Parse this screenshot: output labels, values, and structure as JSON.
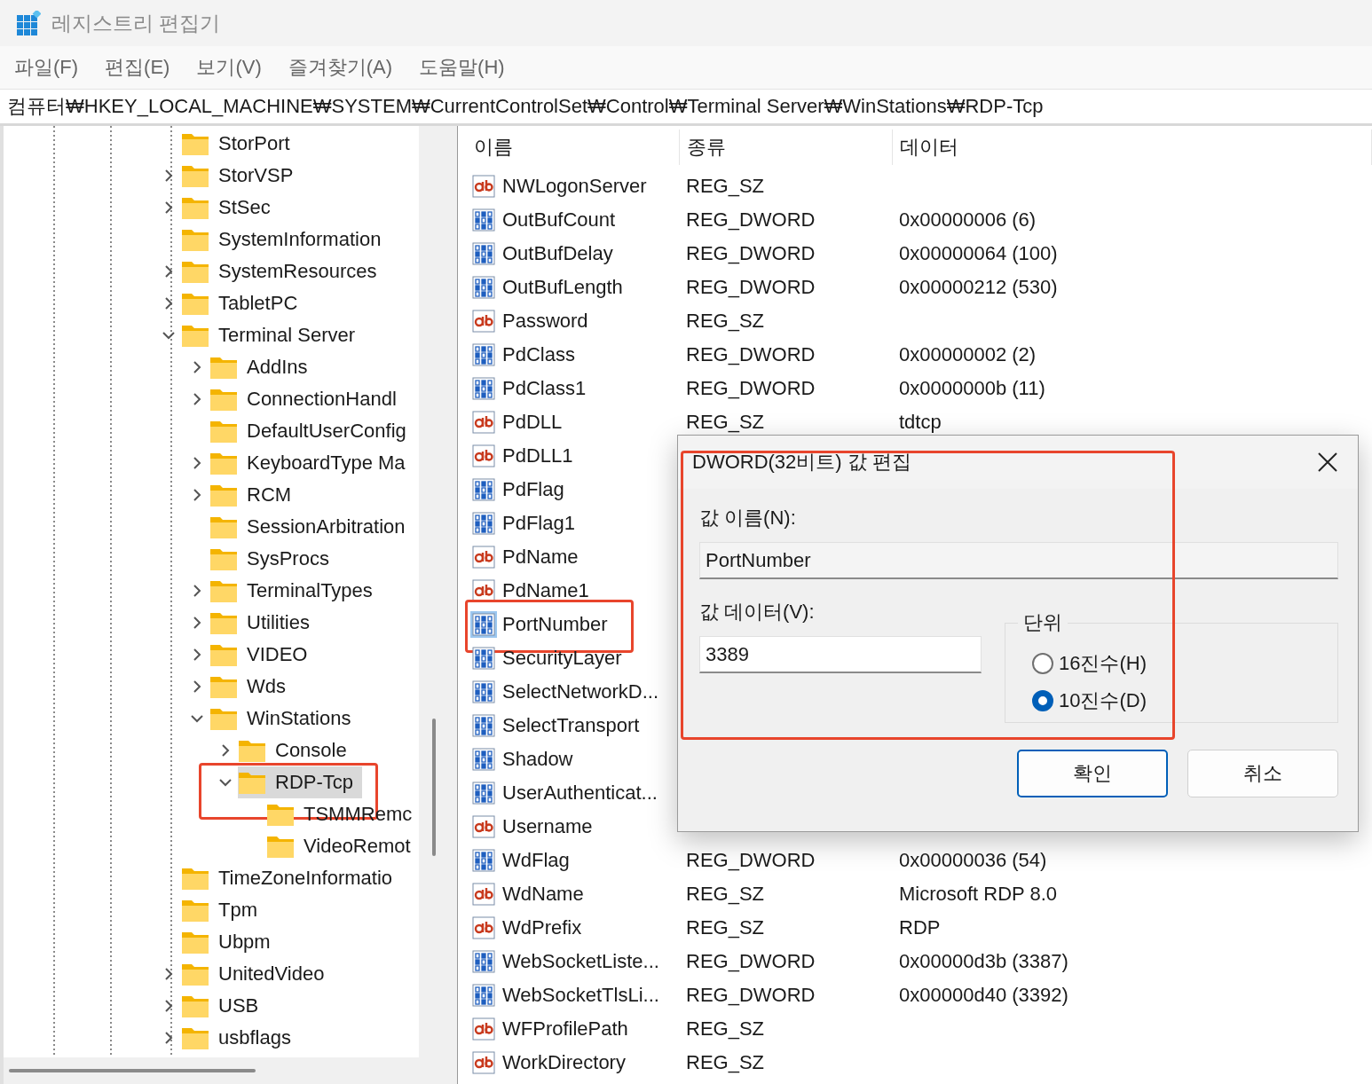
{
  "window": {
    "title": "레지스트리 편집기"
  },
  "menu": [
    "파일(F)",
    "편집(E)",
    "보기(V)",
    "즐겨찾기(A)",
    "도움말(H)"
  ],
  "address": "컴퓨터₩HKEY_LOCAL_MACHINE₩SYSTEM₩CurrentControlSet₩Control₩Terminal Server₩WinStations₩RDP-Tcp",
  "tree": [
    {
      "label": "StorPort"
    },
    {
      "label": "StorVSP",
      "expanded": false
    },
    {
      "label": "StSec",
      "expanded": false
    },
    {
      "label": "SystemInformation"
    },
    {
      "label": "SystemResources",
      "expanded": false
    },
    {
      "label": "TabletPC",
      "expanded": false
    },
    {
      "label": "Terminal Server",
      "expanded": true,
      "children": [
        {
          "label": "AddIns",
          "expanded": false
        },
        {
          "label": "ConnectionHandl",
          "expanded": false
        },
        {
          "label": "DefaultUserConfig"
        },
        {
          "label": "KeyboardType Ma",
          "expanded": false
        },
        {
          "label": "RCM",
          "expanded": false
        },
        {
          "label": "SessionArbitration"
        },
        {
          "label": "SysProcs"
        },
        {
          "label": "TerminalTypes",
          "expanded": false
        },
        {
          "label": "Utilities",
          "expanded": false
        },
        {
          "label": "VIDEO",
          "expanded": false
        },
        {
          "label": "Wds",
          "expanded": false
        },
        {
          "label": "WinStations",
          "expanded": true,
          "children": [
            {
              "label": "Console",
              "expanded": false
            },
            {
              "label": "RDP-Tcp",
              "expanded": true,
              "selected": true,
              "annotated": true,
              "children": [
                {
                  "label": "TSMMRemc"
                },
                {
                  "label": "VideoRemot"
                }
              ]
            }
          ]
        }
      ]
    },
    {
      "label": "TimeZoneInformatio"
    },
    {
      "label": "Tpm"
    },
    {
      "label": "Ubpm"
    },
    {
      "label": "UnitedVideo",
      "expanded": false
    },
    {
      "label": "USB",
      "expanded": false
    },
    {
      "label": "usbflags",
      "expanded": false
    }
  ],
  "table": {
    "columns": [
      "이름",
      "종류",
      "데이터"
    ],
    "rows": [
      {
        "kind": "string",
        "name": "NWLogonServer",
        "type": "REG_SZ",
        "selected": false
      },
      {
        "kind": "binary",
        "name": "OutBufCount",
        "type": "REG_DWORD",
        "data": "0x00000006 (6)",
        "selected": false
      },
      {
        "kind": "binary",
        "name": "OutBufDelay",
        "type": "REG_DWORD",
        "data": "0x00000064 (100)",
        "selected": false
      },
      {
        "kind": "binary",
        "name": "OutBufLength",
        "type": "REG_DWORD",
        "data": "0x00000212 (530)",
        "selected": false
      },
      {
        "kind": "string",
        "name": "Password",
        "type": "REG_SZ",
        "selected": false
      },
      {
        "kind": "binary",
        "name": "PdClass",
        "type": "REG_DWORD",
        "data": "0x00000002 (2)",
        "selected": false
      },
      {
        "kind": "binary",
        "name": "PdClass1",
        "type": "REG_DWORD",
        "data": "0x0000000b (11)",
        "selected": false
      },
      {
        "kind": "string",
        "name": "PdDLL",
        "type": "REG_SZ",
        "data": "tdtcp",
        "selected": false
      },
      {
        "kind": "string",
        "name": "PdDLL1",
        "selected": false
      },
      {
        "kind": "binary",
        "name": "PdFlag",
        "selected": false
      },
      {
        "kind": "binary",
        "name": "PdFlag1",
        "selected": false
      },
      {
        "kind": "string",
        "name": "PdName",
        "selected": false
      },
      {
        "kind": "string",
        "name": "PdName1",
        "selected": false
      },
      {
        "kind": "binary",
        "name": "PortNumber",
        "selected": true,
        "annotated": true
      },
      {
        "kind": "binary",
        "name": "SecurityLayer",
        "selected": false
      },
      {
        "kind": "binary",
        "name": "SelectNetworkD...",
        "selected": false
      },
      {
        "kind": "binary",
        "name": "SelectTransport",
        "selected": false
      },
      {
        "kind": "binary",
        "name": "Shadow",
        "selected": false
      },
      {
        "kind": "binary",
        "name": "UserAuthenticat...",
        "selected": false
      },
      {
        "kind": "string",
        "name": "Username",
        "selected": false
      },
      {
        "kind": "binary",
        "name": "WdFlag",
        "type": "REG_DWORD",
        "data": "0x00000036 (54)",
        "selected": false
      },
      {
        "kind": "string",
        "name": "WdName",
        "type": "REG_SZ",
        "data": "Microsoft RDP 8.0",
        "selected": false
      },
      {
        "kind": "string",
        "name": "WdPrefix",
        "type": "REG_SZ",
        "data": "RDP",
        "selected": false
      },
      {
        "kind": "binary",
        "name": "WebSocketListe...",
        "type": "REG_DWORD",
        "data": "0x00000d3b (3387)",
        "selected": false
      },
      {
        "kind": "binary",
        "name": "WebSocketTlsLi...",
        "type": "REG_DWORD",
        "data": "0x00000d40 (3392)",
        "selected": false
      },
      {
        "kind": "string",
        "name": "WFProfilePath",
        "type": "REG_SZ",
        "selected": false
      },
      {
        "kind": "string",
        "name": "WorkDirectory",
        "type": "REG_SZ",
        "selected": false
      }
    ]
  },
  "dialog": {
    "title": "DWORD(32비트) 값 편집",
    "annotated": true,
    "name_label": "값 이름(N):",
    "name_value": "PortNumber",
    "data_label": "값 데이터(V):",
    "data_value": "3389",
    "group_label": "단위",
    "units": [
      {
        "label": "16진수(H)",
        "selected": false
      },
      {
        "label": "10진수(D)",
        "selected": true
      }
    ],
    "buttons": [
      {
        "label": "확인",
        "default": true
      },
      {
        "label": "취소",
        "default": false
      }
    ]
  }
}
